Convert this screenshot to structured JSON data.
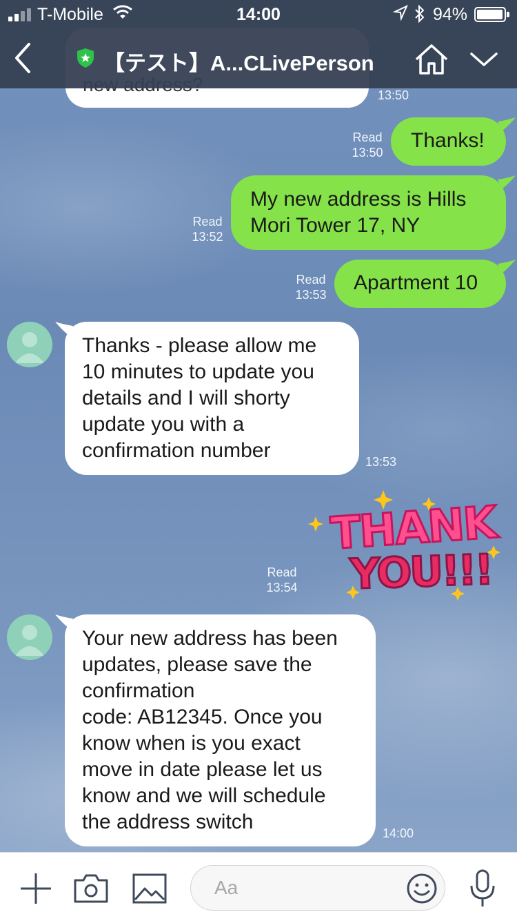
{
  "status_bar": {
    "carrier": "T-Mobile",
    "time": "14:00",
    "battery_percent": "94%",
    "battery_level": 0.94
  },
  "header": {
    "title": "【テスト】A...CLivePerson",
    "icons": [
      "back-icon",
      "shield-icon",
      "home-icon",
      "chevron-down-icon"
    ]
  },
  "partial_message": {
    "text": "new address?",
    "time": "13:50"
  },
  "messages": [
    {
      "side": "out",
      "text": "Thanks!",
      "status": "Read",
      "time": "13:50"
    },
    {
      "side": "out",
      "lines": [
        "My new address is Hills",
        "Mori Tower 17, NY"
      ],
      "status": "Read",
      "time": "13:52"
    },
    {
      "side": "out",
      "text": "Apartment 10",
      "status": "Read",
      "time": "13:53"
    },
    {
      "side": "in",
      "lines": [
        "Thanks - please allow me",
        "10 minutes to update you",
        "details and I will shorty",
        "update you with a",
        "confirmation number"
      ],
      "time": "13:53"
    },
    {
      "side": "out",
      "type": "sticker",
      "sticker_lines": [
        "THANK",
        "YOU!!!"
      ],
      "status": "Read",
      "time": "13:54"
    },
    {
      "side": "in",
      "lines": [
        "Your new address has been",
        "updates, please save the",
        "confirmation",
        "code: AB12345. Once you",
        "know when is you exact",
        "move in date please let us",
        "know and we will schedule",
        "the address switch"
      ],
      "time": "14:00"
    }
  ],
  "composer": {
    "placeholder": "Aa",
    "icons": [
      "plus-icon",
      "camera-icon",
      "image-icon",
      "emoji-icon",
      "microphone-icon"
    ]
  },
  "colors": {
    "header_bg": "#343f52",
    "outgoing_bubble": "#85e249",
    "incoming_bubble": "#ffffff",
    "chat_bg": "#6f8cb8",
    "avatar": "#8fd1b8",
    "shield": "#2fc24a"
  }
}
